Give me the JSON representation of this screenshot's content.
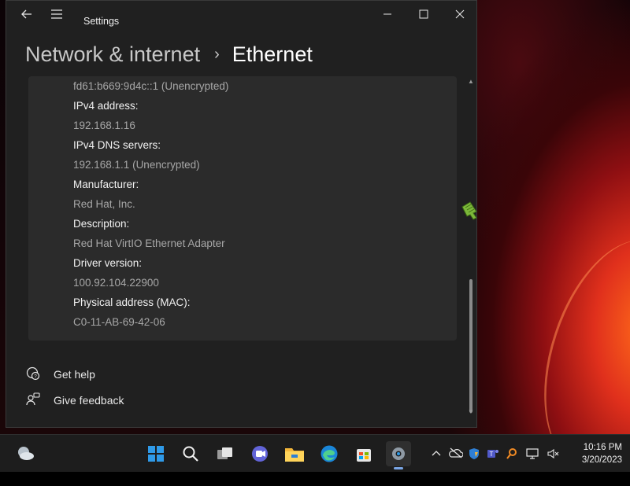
{
  "window": {
    "app_title": "Settings",
    "breadcrumb": {
      "parent": "Network & internet",
      "separator": "›",
      "current": "Ethernet"
    },
    "controls": {
      "minimize": "—",
      "maximize": "☐",
      "close": "✕"
    }
  },
  "properties": [
    {
      "kind": "value",
      "text": "fd61:b669:9d4c::1 (Unencrypted)"
    },
    {
      "kind": "label",
      "text": "IPv4 address:"
    },
    {
      "kind": "value",
      "text": "192.168.1.16"
    },
    {
      "kind": "label",
      "text": "IPv4 DNS servers:"
    },
    {
      "kind": "value",
      "text": "192.168.1.1 (Unencrypted)"
    },
    {
      "kind": "label",
      "text": "Manufacturer:"
    },
    {
      "kind": "value",
      "text": "Red Hat, Inc."
    },
    {
      "kind": "label",
      "text": "Description:"
    },
    {
      "kind": "value",
      "text": "Red Hat VirtIO Ethernet Adapter"
    },
    {
      "kind": "label",
      "text": "Driver version:"
    },
    {
      "kind": "value",
      "text": "100.92.104.22900"
    },
    {
      "kind": "label",
      "text": "Physical address (MAC):"
    },
    {
      "kind": "value",
      "text": "C0-11-AB-69-42-06"
    }
  ],
  "help": {
    "get_help": "Get help",
    "give_feedback": "Give feedback"
  },
  "taskbar": {
    "apps": [
      "weather-widget",
      "start",
      "search",
      "task-view",
      "chat",
      "file-explorer",
      "edge",
      "store",
      "settings"
    ],
    "active_app": "settings"
  },
  "clock": {
    "time": "10:16 PM",
    "date": "3/20/2023"
  },
  "colors": {
    "window_bg": "#202020",
    "card_bg": "#2b2b2b",
    "accent": "#7aa6e6"
  }
}
